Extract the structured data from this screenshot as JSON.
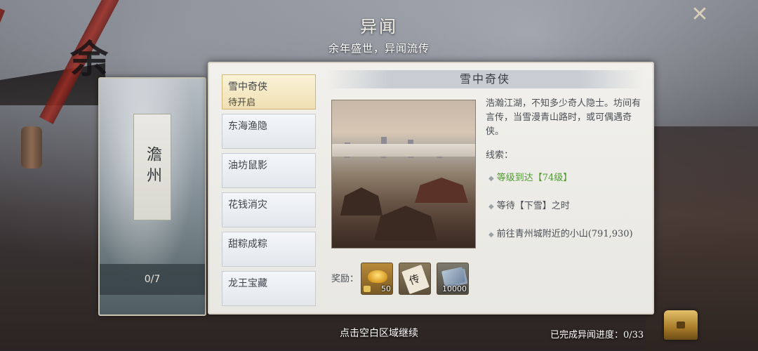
{
  "header": {
    "title": "异闻",
    "subtitle": "余年盛世，异闻流传",
    "close_icon": "close-icon"
  },
  "region": {
    "name": "澹州",
    "progress": "0/7"
  },
  "quest_list": [
    {
      "name": "雪中奇侠",
      "status": "待开启",
      "selected": true
    },
    {
      "name": "东海渔隐",
      "status": "",
      "selected": false
    },
    {
      "name": "油坊鼠影",
      "status": "",
      "selected": false
    },
    {
      "name": "花钱消灾",
      "status": "",
      "selected": false
    },
    {
      "name": "甜粽成粽",
      "status": "",
      "selected": false
    },
    {
      "name": "龙王宝藏",
      "status": "",
      "selected": false
    }
  ],
  "detail": {
    "title": "雪中奇侠",
    "description": "浩瀚江湖，不知多少奇人隐士。坊间有言传，当雪漫青山路时，或可偶遇奇侠。",
    "clue_label": "线索：",
    "clues": [
      {
        "text": "等级到达【74级】",
        "met": true
      },
      {
        "text": "等待【下雪】之时",
        "met": false
      },
      {
        "text": "前往青州城附近的小山(791,930)",
        "met": false
      }
    ],
    "reward_label": "奖励：",
    "rewards": [
      {
        "icon": "gold-ingot-icon",
        "count": "50",
        "locked": true
      },
      {
        "icon": "scroll-icon",
        "glyph": "传",
        "count": ""
      },
      {
        "icon": "banknotes-icon",
        "count": "10000"
      }
    ]
  },
  "footer": {
    "hint": "点击空白区域继续",
    "progress": "已完成异闻进度：0/33",
    "chest_icon": "treasure-chest-icon"
  },
  "colors": {
    "selected_bg": "#efe0b3",
    "clue_met": "#4f9b2f",
    "panel_bg": "#f1f0ec"
  }
}
